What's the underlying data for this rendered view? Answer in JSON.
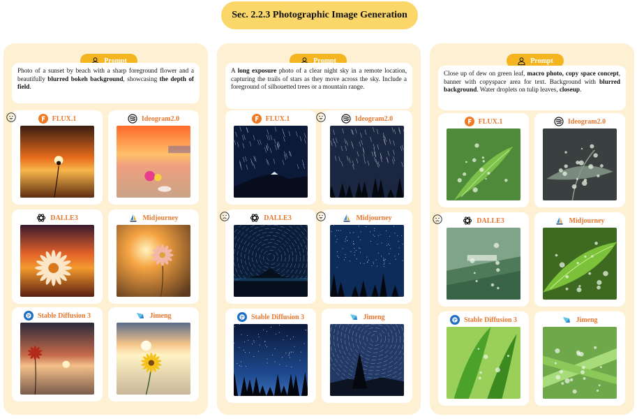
{
  "title": "Sec. 2.2.3 Photographic Image Generation",
  "prompt_label": "Prompt",
  "columns": [
    {
      "prompt_segments": [
        {
          "text": "Photo of a sunset by beach with a sharp foreground flower and a beautifully ",
          "bold": false
        },
        {
          "text": "blurred bokeh background",
          "bold": true
        },
        {
          "text": ", showcasing ",
          "bold": false
        },
        {
          "text": "the depth of field",
          "bold": true
        },
        {
          "text": ".",
          "bold": false
        }
      ],
      "models": [
        {
          "name": "FLUX.1",
          "logo": "flux-logo",
          "rating": "happy",
          "image": "sunset-flower-silhouette"
        },
        {
          "name": "Ideogram2.0",
          "logo": "ideogram-logo",
          "rating": "",
          "image": "sunset-beach-pink-flower"
        },
        {
          "name": "DALLE3",
          "logo": "openai-logo",
          "rating": "",
          "image": "sunset-daisy-orange"
        },
        {
          "name": "Midjourney",
          "logo": "midjourney-logo",
          "rating": "",
          "image": "sunset-pink-flower-bokeh"
        },
        {
          "name": "Stable Diffusion 3",
          "logo": "sd3-logo",
          "rating": "",
          "image": "sunset-beach-red-flower"
        },
        {
          "name": "Jimeng",
          "logo": "jimeng-logo",
          "rating": "",
          "image": "sunset-beach-yellow-flower"
        }
      ]
    },
    {
      "prompt_segments": [
        {
          "text": "A ",
          "bold": false
        },
        {
          "text": "long exposure",
          "bold": true
        },
        {
          "text": " photo of a clear night sky in a remote location, capturing the trails of stars as they move across the sky. Include a foreground of silhouetted trees or a mountain range.",
          "bold": false
        }
      ],
      "models": [
        {
          "name": "FLUX.1",
          "logo": "flux-logo",
          "rating": "",
          "image": "star-trails-mountain"
        },
        {
          "name": "Ideogram2.0",
          "logo": "ideogram-logo",
          "rating": "happy",
          "image": "star-trails-trees"
        },
        {
          "name": "DALLE3",
          "logo": "openai-logo",
          "rating": "sad",
          "image": "circular-star-trails"
        },
        {
          "name": "Midjourney",
          "logo": "midjourney-logo",
          "rating": "happy",
          "image": "starry-sky-trees"
        },
        {
          "name": "Stable Diffusion 3",
          "logo": "sd3-logo",
          "rating": "",
          "image": "night-sky-tree-line"
        },
        {
          "name": "Jimeng",
          "logo": "jimeng-logo",
          "rating": "",
          "image": "star-trails-pine"
        }
      ]
    },
    {
      "prompt_segments": [
        {
          "text": "Close up of dew on green leaf, ",
          "bold": false
        },
        {
          "text": "macro photo, copy space concept",
          "bold": true
        },
        {
          "text": ", banner with copyspace area for text. Background with ",
          "bold": false
        },
        {
          "text": "blurred background",
          "bold": true
        },
        {
          "text": ". Water droplets on tulip leaves, ",
          "bold": false
        },
        {
          "text": "closeup",
          "bold": true
        },
        {
          "text": ".",
          "bold": false
        }
      ],
      "models": [
        {
          "name": "FLUX.1",
          "logo": "flux-logo",
          "rating": "",
          "image": "leaf-dew-green"
        },
        {
          "name": "Ideogram2.0",
          "logo": "ideogram-logo",
          "rating": "",
          "image": "leaf-dew-dark"
        },
        {
          "name": "DALLE3",
          "logo": "openai-logo",
          "rating": "sad",
          "image": "leaves-banner-text"
        },
        {
          "name": "Midjourney",
          "logo": "midjourney-logo",
          "rating": "",
          "image": "leaf-dew-macro"
        },
        {
          "name": "Stable Diffusion 3",
          "logo": "sd3-logo",
          "rating": "",
          "image": "tulip-leaves-drops"
        },
        {
          "name": "Jimeng",
          "logo": "jimeng-logo",
          "rating": "",
          "image": "blades-water-drops"
        }
      ]
    }
  ],
  "colors": {
    "title_bg": "#fbd76a",
    "panel_bg": "#fdf0d3",
    "pill_bg": "#f4b520",
    "model_label": "#e8772e"
  }
}
